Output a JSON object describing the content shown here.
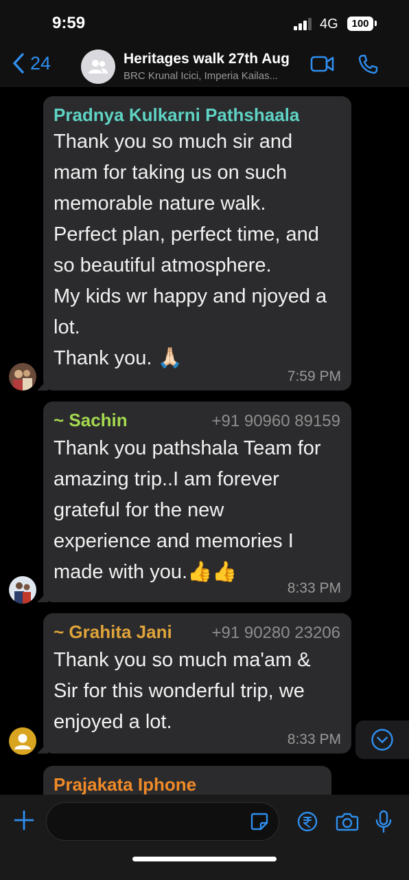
{
  "status": {
    "time": "9:59",
    "network": "4G",
    "battery": "100"
  },
  "header": {
    "back_count": "24",
    "title": "Heritages walk 27th Aug",
    "subtitle": "BRC Krunal Icici, Imperia Kailas..."
  },
  "messages": [
    {
      "sender": "Pradnya Kulkarni Pathshaala",
      "sender_color": "#5fd3c4",
      "phone": "",
      "text": "Thank you so much sir and\nmam for taking us on such\nmemorable nature walk.\nPerfect plan, perfect time, and\nso beautiful atmosphere.\nMy kids wr happy and njoyed a\nlot.\nThank you. 🙏🏻",
      "time": "7:59 PM"
    },
    {
      "sender": "~ Sachin",
      "sender_color": "#a5d94f",
      "phone": "+91 90960 89159",
      "text": "Thank  you pathshala Team for\namazing trip..I am forever\ngrateful for the new\nexperience and memories I\nmade with you.👍👍",
      "time": "8:33 PM"
    },
    {
      "sender": "~ Grahita Jani",
      "sender_color": "#e0a43a",
      "phone": "+91 90280 23206",
      "text": "Thank you so much ma'am &\nSir for this wonderful trip, we\nenjoyed a lot.",
      "time": "8:33 PM"
    },
    {
      "sender": "Prajakata Iphone",
      "sender_color": "#f08a28",
      "phone": "",
      "text": "",
      "time": ""
    }
  ],
  "colors": {
    "accent": "#2f8ff0",
    "bubble": "#2b2b2d"
  }
}
